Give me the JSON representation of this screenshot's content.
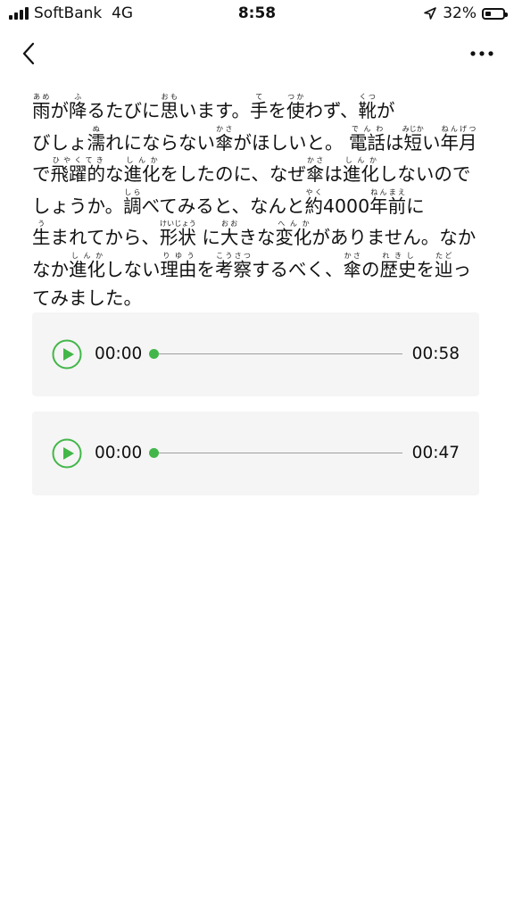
{
  "status_bar": {
    "carrier": "SoftBank",
    "network": "4G",
    "time": "8:58",
    "battery": "32%"
  },
  "nav": {
    "back_icon": "chevron-left-icon",
    "more_icon": "more-horizontal-icon"
  },
  "article": {
    "lines": [
      [
        {
          "text": "雨",
          "ruby": "あめ"
        },
        {
          "text": "が"
        },
        {
          "text": "降",
          "ruby": "ふ"
        },
        {
          "text": "るたびに"
        },
        {
          "text": "思",
          "ruby": "おも"
        },
        {
          "text": "います。"
        },
        {
          "text": "手",
          "ruby": "て"
        },
        {
          "text": "を"
        },
        {
          "text": "使",
          "ruby": "つか"
        },
        {
          "text": "わず、"
        },
        {
          "text": "靴",
          "ruby": "くつ"
        },
        {
          "text": "が"
        }
      ],
      [
        {
          "text": "びしょ"
        },
        {
          "text": "濡",
          "ruby": "ぬ"
        },
        {
          "text": "れにならない"
        },
        {
          "text": "傘",
          "ruby": "かさ"
        },
        {
          "text": "がほしいと。 "
        },
        {
          "text": "電話",
          "ruby": "でんわ"
        },
        {
          "text": "は"
        },
        {
          "text": "短",
          "ruby": "みじか"
        },
        {
          "text": "い"
        },
        {
          "text": "年月",
          "ruby": "ねんげつ"
        }
      ],
      [
        {
          "text": "で"
        },
        {
          "text": "飛躍的",
          "ruby": "ひやくてき"
        },
        {
          "text": "な"
        },
        {
          "text": "進化",
          "ruby": "しんか"
        },
        {
          "text": "をしたのに、なぜ"
        },
        {
          "text": "傘",
          "ruby": "かさ"
        },
        {
          "text": "は"
        },
        {
          "text": "進化",
          "ruby": "しんか"
        },
        {
          "text": "しないので"
        }
      ],
      [
        {
          "text": "しょうか。"
        },
        {
          "text": "調",
          "ruby": "しら"
        },
        {
          "text": "べてみると、なんと"
        },
        {
          "text": "約",
          "ruby": "やく"
        },
        {
          "text": "4000"
        },
        {
          "text": "年前",
          "ruby": "ねんまえ"
        },
        {
          "text": "に"
        }
      ],
      [
        {
          "text": "生",
          "ruby": "う"
        },
        {
          "text": "まれてから、"
        },
        {
          "text": "形状",
          "ruby": "けいじょう"
        },
        {
          "text": " に"
        },
        {
          "text": "大",
          "ruby": "おお"
        },
        {
          "text": "きな"
        },
        {
          "text": "変化",
          "ruby": "へんか"
        },
        {
          "text": "がありません。なか"
        }
      ],
      [
        {
          "text": "なか"
        },
        {
          "text": "進化",
          "ruby": "しんか"
        },
        {
          "text": "しない"
        },
        {
          "text": "理由",
          "ruby": "りゆう"
        },
        {
          "text": "を"
        },
        {
          "text": "考察",
          "ruby": "こうさつ"
        },
        {
          "text": "するべく、"
        },
        {
          "text": "傘",
          "ruby": "かさ"
        },
        {
          "text": "の"
        },
        {
          "text": "歴史",
          "ruby": "れきし"
        },
        {
          "text": "を"
        },
        {
          "text": "辿",
          "ruby": "たど"
        },
        {
          "text": "っ"
        }
      ],
      [
        {
          "text": "てみました。"
        }
      ]
    ]
  },
  "audio_players": [
    {
      "current_time": "00:00",
      "duration": "00:58",
      "progress": 0,
      "play_icon": "play-circle-icon"
    },
    {
      "current_time": "00:00",
      "duration": "00:47",
      "progress": 0,
      "play_icon": "play-circle-icon"
    }
  ],
  "colors": {
    "accent": "#43b649",
    "player_bg": "#f5f5f5",
    "track": "#9e9e9e",
    "text": "#111111"
  }
}
